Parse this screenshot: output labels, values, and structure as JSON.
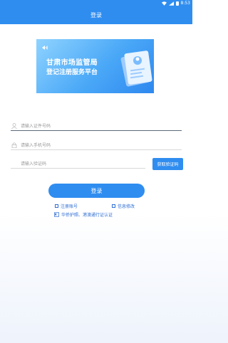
{
  "status": {
    "time": "8:53"
  },
  "header": {
    "title": "登录"
  },
  "banner": {
    "line1": "甘肃市场监管局",
    "line2": "登记注册服务平台"
  },
  "form": {
    "id_placeholder": "请输入证件号码",
    "phone_placeholder": "请输入手机号码",
    "code_placeholder": "请输入验证码",
    "get_code_label": "获取验证码",
    "login_label": "登录"
  },
  "links": {
    "register": "注册账号",
    "modify": "信息修改",
    "auth": "华侨护照、港澳通行证认证"
  },
  "colors": {
    "primary": "#2f8df0",
    "link": "#2f6fd6"
  }
}
